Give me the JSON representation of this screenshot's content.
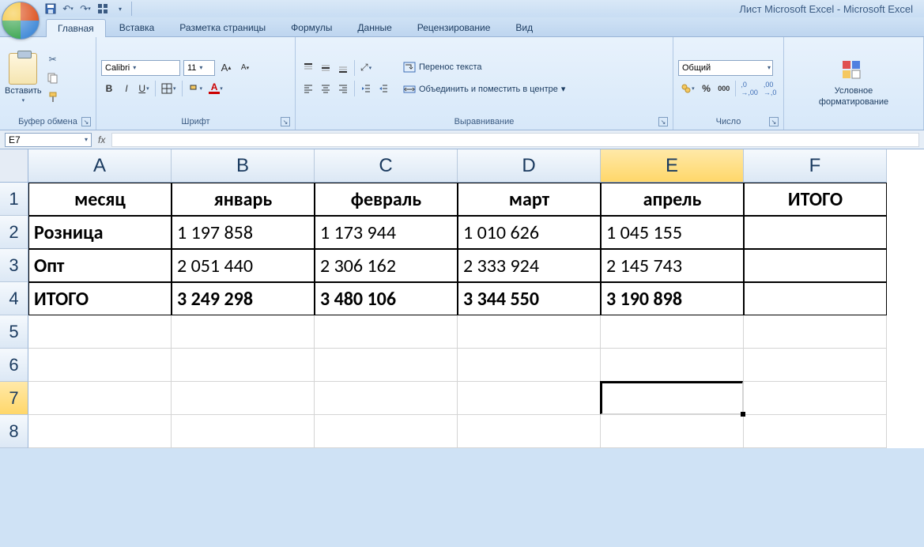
{
  "app": {
    "title": "Лист Microsoft Excel - Microsoft Excel"
  },
  "tabs": {
    "home": "Главная",
    "insert": "Вставка",
    "layout": "Разметка страницы",
    "formulas": "Формулы",
    "data": "Данные",
    "review": "Рецензирование",
    "view": "Вид"
  },
  "ribbon": {
    "clipboard": {
      "label": "Буфер обмена",
      "paste": "Вставить"
    },
    "font": {
      "label": "Шрифт",
      "name": "Calibri",
      "size": "11"
    },
    "alignment": {
      "label": "Выравнивание",
      "wrap": "Перенос текста",
      "merge": "Объединить и поместить в центре"
    },
    "number": {
      "label": "Число",
      "format": "Общий"
    },
    "conditional": {
      "label": "Условное",
      "label2": "форматирование"
    }
  },
  "namebox": "E7",
  "columns": [
    "A",
    "B",
    "C",
    "D",
    "E",
    "F"
  ],
  "rows": [
    "1",
    "2",
    "3",
    "4",
    "5",
    "6",
    "7",
    "8"
  ],
  "cells": {
    "A1": "месяц",
    "B1": "январь",
    "C1": "февраль",
    "D1": "март",
    "E1": "апрель",
    "F1": "ИТОГО",
    "A2": "Розница",
    "B2": "1 197 858",
    "C2": "1 173 944",
    "D2": "1 010 626",
    "E2": "1 045 155",
    "A3": "Опт",
    "B3": "2 051 440",
    "C3": "2 306 162",
    "D3": "2 333 924",
    "E3": "2 145 743",
    "A4": "ИТОГО",
    "B4": "3 249 298",
    "C4": "3 480 106",
    "D4": "3 344 550",
    "E4": "3 190 898"
  },
  "active_cell": "E7"
}
